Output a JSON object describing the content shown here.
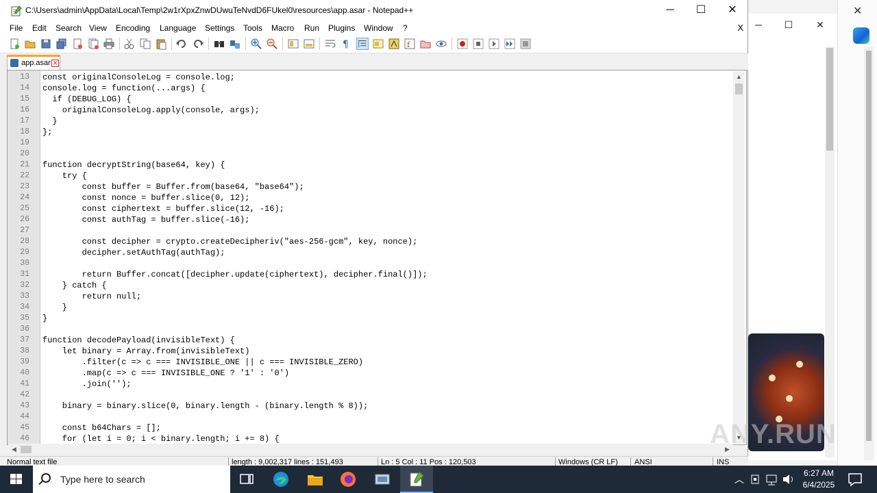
{
  "window": {
    "title": "C:\\Users\\admin\\AppData\\Local\\Temp\\2w1rXpxZnwDUwuTeNvdD6FUkel0\\resources\\app.asar - Notepad++",
    "minimize": "─",
    "maximize": "☐",
    "close": "✕"
  },
  "menu": {
    "items": [
      "File",
      "Edit",
      "Search",
      "View",
      "Encoding",
      "Language",
      "Settings",
      "Tools",
      "Macro",
      "Run",
      "Plugins",
      "Window",
      "?"
    ],
    "close_doc": "X"
  },
  "toolbar": {
    "icons": [
      "new-file-icon",
      "open-file-icon",
      "save-icon",
      "save-all-icon",
      "close-icon",
      "close-all-icon",
      "print-icon",
      "cut-icon",
      "copy-icon",
      "paste-icon",
      "undo-icon",
      "redo-icon",
      "find-icon",
      "replace-icon",
      "zoom-in-icon",
      "zoom-out-icon",
      "sync-vertical-icon",
      "sync-horizontal-icon",
      "word-wrap-icon",
      "show-all-chars-icon",
      "indent-guide-icon",
      "udl-icon",
      "doc-map-icon",
      "function-list-icon",
      "folder-workspace-icon",
      "monitoring-icon",
      "record-macro-icon",
      "stop-macro-icon",
      "play-macro-icon",
      "run-macro-multiple-icon",
      "save-macro-icon"
    ]
  },
  "tab": {
    "label": "app.asar",
    "close": "✕"
  },
  "code_lines": [
    {
      "n": "13",
      "text": "const originalConsoleLog = console.log;"
    },
    {
      "n": "14",
      "text": "console.log = function(...args) {"
    },
    {
      "n": "15",
      "text": "  if (DEBUG_LOG) {"
    },
    {
      "n": "16",
      "text": "    originalConsoleLog.apply(console, args);"
    },
    {
      "n": "17",
      "text": "  }"
    },
    {
      "n": "18",
      "text": "};"
    },
    {
      "n": "19",
      "text": ""
    },
    {
      "n": "20",
      "text": ""
    },
    {
      "n": "21",
      "text": "function decryptString(base64, key) {"
    },
    {
      "n": "22",
      "text": "    try {"
    },
    {
      "n": "23",
      "text": "        const buffer = Buffer.from(base64, \"base64\");"
    },
    {
      "n": "24",
      "text": "        const nonce = buffer.slice(0, 12);"
    },
    {
      "n": "25",
      "text": "        const ciphertext = buffer.slice(12, -16);"
    },
    {
      "n": "26",
      "text": "        const authTag = buffer.slice(-16);"
    },
    {
      "n": "27",
      "text": ""
    },
    {
      "n": "28",
      "text": "        const decipher = crypto.createDecipheriv(\"aes-256-gcm\", key, nonce);"
    },
    {
      "n": "29",
      "text": "        decipher.setAuthTag(authTag);"
    },
    {
      "n": "30",
      "text": ""
    },
    {
      "n": "31",
      "text": "        return Buffer.concat([decipher.update(ciphertext), decipher.final()]);"
    },
    {
      "n": "32",
      "text": "    } catch {"
    },
    {
      "n": "33",
      "text": "        return null;"
    },
    {
      "n": "34",
      "text": "    }"
    },
    {
      "n": "35",
      "text": "}"
    },
    {
      "n": "36",
      "text": ""
    },
    {
      "n": "37",
      "text": "function decodePayload(invisibleText) {"
    },
    {
      "n": "38",
      "text": "    let binary = Array.from(invisibleText)"
    },
    {
      "n": "39",
      "text": "        .filter(c => c === INVISIBLE_ONE || c === INVISIBLE_ZERO)"
    },
    {
      "n": "40",
      "text": "        .map(c => c === INVISIBLE_ONE ? '1' : '0')"
    },
    {
      "n": "41",
      "text": "        .join('');"
    },
    {
      "n": "42",
      "text": ""
    },
    {
      "n": "43",
      "text": "    binary = binary.slice(0, binary.length - (binary.length % 8));"
    },
    {
      "n": "44",
      "text": ""
    },
    {
      "n": "45",
      "text": "    const b64Chars = [];"
    },
    {
      "n": "46",
      "text": "    for (let i = 0; i < binary.length; i += 8) {"
    }
  ],
  "status": {
    "file_type": "Normal text file",
    "length": "length : 9,002,317    lines : 151,493",
    "position": "Ln : 5    Col : 11    Pos : 120,503",
    "eol": "Windows (CR LF)",
    "encoding": "ANSI",
    "mode": "INS"
  },
  "taskbar": {
    "search_placeholder": "Type here to search",
    "time": "6:27 AM",
    "date": "6/4/2025"
  },
  "watermark": "ANY.RUN",
  "colors": {
    "taskbar_bg": "#1f2a38",
    "gutter_bg": "#e4e4e4",
    "tab_accent": "#f5a623"
  }
}
